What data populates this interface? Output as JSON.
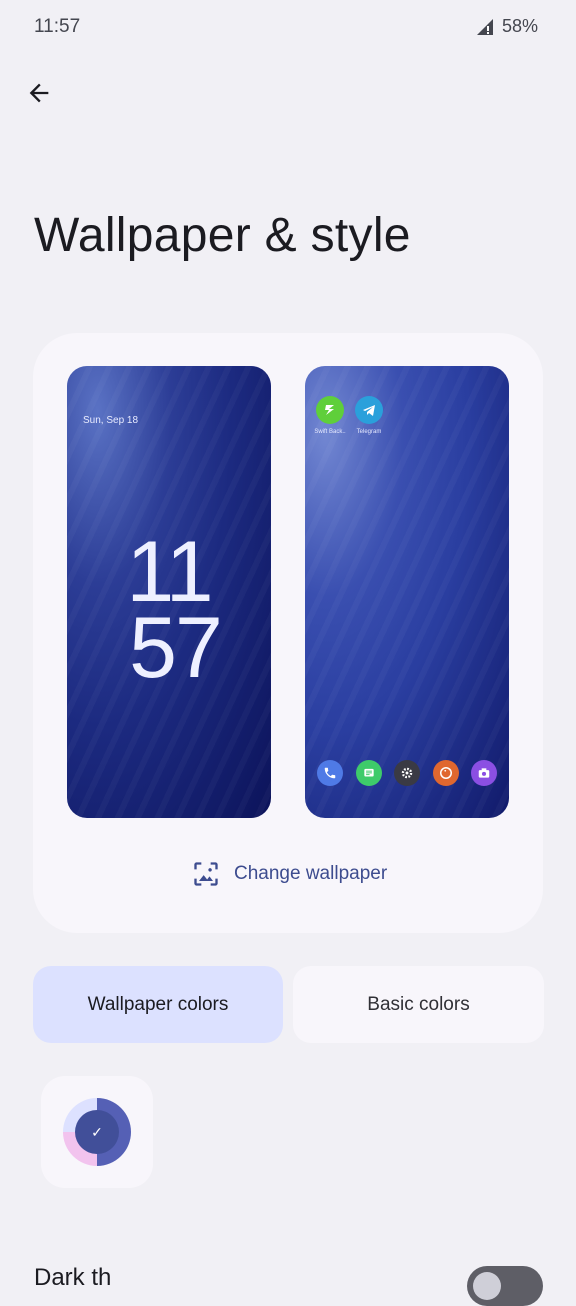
{
  "status_bar": {
    "time": "11:57",
    "battery": "58%"
  },
  "page": {
    "title": "Wallpaper & style"
  },
  "lock_preview": {
    "date": "Sun, Sep 18",
    "hour": "11",
    "minute": "57"
  },
  "home_preview": {
    "apps": [
      {
        "label": "Swift Back.."
      },
      {
        "label": "Telegram"
      }
    ]
  },
  "change_wallpaper": {
    "label": "Change wallpaper"
  },
  "tabs": [
    {
      "label": "Wallpaper colors"
    },
    {
      "label": "Basic colors"
    }
  ],
  "dark_theme": {
    "label": "Dark th"
  },
  "colors": {
    "accent": "#3d4c8f",
    "active_tab": "#dce1ff",
    "swatch_primary": "#414f99"
  }
}
